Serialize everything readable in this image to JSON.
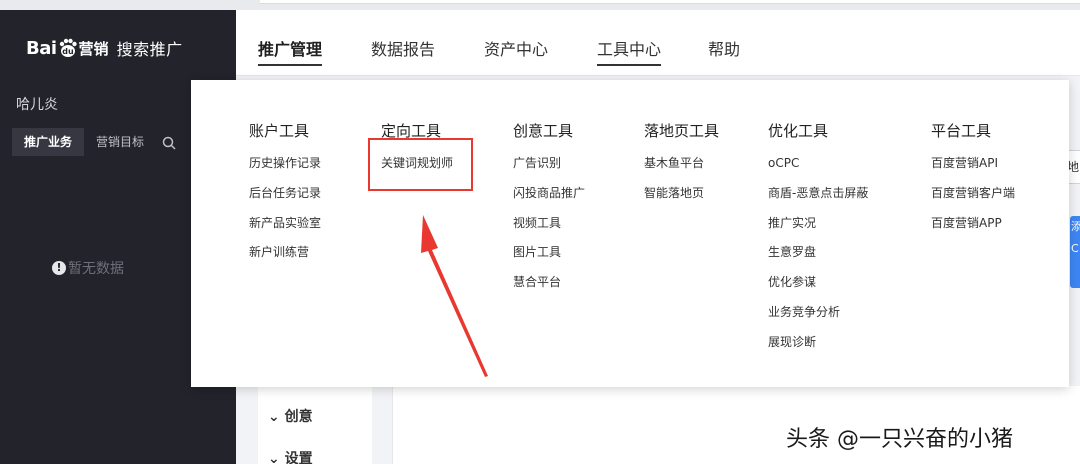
{
  "brand": {
    "logo_prefix": "Bai",
    "logo_du": "du",
    "logo_suffix": "营销",
    "product": "搜索推广"
  },
  "sidebar": {
    "user_name": "哈儿炎",
    "tabs": [
      {
        "label": "推广业务",
        "active": true
      },
      {
        "label": "营销目标",
        "active": false
      }
    ],
    "empty_text": "暂无数据"
  },
  "header_nav": [
    {
      "label": "推广管理",
      "active": true
    },
    {
      "label": "数据报告",
      "active": false
    },
    {
      "label": "资产中心",
      "active": false
    },
    {
      "label": "工具中心",
      "active": false
    },
    {
      "label": "帮助",
      "active": false
    }
  ],
  "mega_menu": {
    "columns": [
      {
        "title": "账户工具",
        "items": [
          "历史操作记录",
          "后台任务记录",
          "新产品实验室",
          "新户训练营"
        ]
      },
      {
        "title": "定向工具",
        "items": [
          "关键词规划师"
        ]
      },
      {
        "title": "创意工具",
        "items": [
          "广告识别",
          "闪投商品推广",
          "视频工具",
          "图片工具",
          "慧合平台"
        ]
      },
      {
        "title": "落地页工具",
        "items": [
          "基木鱼平台",
          "智能落地页"
        ]
      },
      {
        "title": "优化工具",
        "items": [
          "oCPC",
          "商盾-恶意点击屏蔽",
          "推广实况",
          "生意罗盘",
          "优化参谋",
          "业务竞争分析",
          "展现诊断"
        ]
      },
      {
        "title": "平台工具",
        "items": [
          "百度营销API",
          "百度营销客户端",
          "百度营销APP"
        ]
      }
    ]
  },
  "content": {
    "collapse_items": [
      "创意",
      "设置"
    ],
    "right_input_fragment": "地",
    "right_button_fragment": [
      "添",
      "C"
    ]
  },
  "annotation": {
    "highlight_color": "#e8382f"
  },
  "watermark": "头条 @一只兴奋的小猪"
}
